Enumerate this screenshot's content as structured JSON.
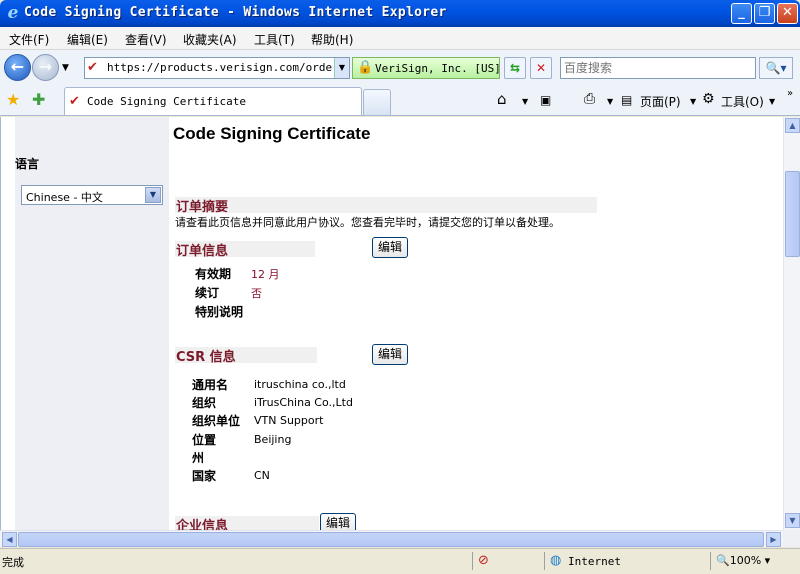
{
  "window": {
    "title": "Code Signing Certificate - Windows Internet Explorer",
    "min": "_",
    "max": "❐",
    "close": "✕"
  },
  "menu": [
    "文件(F)",
    "编辑(E)",
    "查看(V)",
    "收藏夹(A)",
    "工具(T)",
    "帮助(H)"
  ],
  "address": {
    "url": "https://products.verisign.com/orders/e",
    "cert": "VeriSign, Inc. [US]",
    "search_placeholder": "百度搜索"
  },
  "tab": {
    "label": "Code Signing Certificate"
  },
  "commandbar": {
    "page": "页面(P)",
    "tools": "工具(O)"
  },
  "sidebar": {
    "heading": "语言",
    "language": "Chinese - 中文"
  },
  "page": {
    "title": "Code Signing Certificate",
    "summary_heading": "订单摘要",
    "intro": "请查看此页信息并同意此用户协议。您查看完毕时，请提交您的订单以备处理。",
    "edit_label": "编辑",
    "order_info": {
      "heading": "订单信息",
      "validity_label": "有效期",
      "validity_value": "12 月",
      "renewal_label": "续订",
      "renewal_value": "否",
      "notes_label": "特别说明"
    },
    "csr_info": {
      "heading": "CSR 信息",
      "common_name_label": "通用名",
      "common_name_value": "itruschina co.,ltd",
      "org_label": "组织",
      "org_value": "iTrusChina Co.,Ltd",
      "ou_label": "组织单位",
      "ou_value": "VTN Support",
      "locality_label": "位置",
      "locality_value": "Beijing",
      "state_label": "州",
      "state_value": "",
      "country_label": "国家",
      "country_value": "CN"
    },
    "company_info": {
      "heading": "企业信息"
    }
  },
  "status": {
    "text": "完成",
    "zone": "Internet",
    "zoom": "100%"
  }
}
